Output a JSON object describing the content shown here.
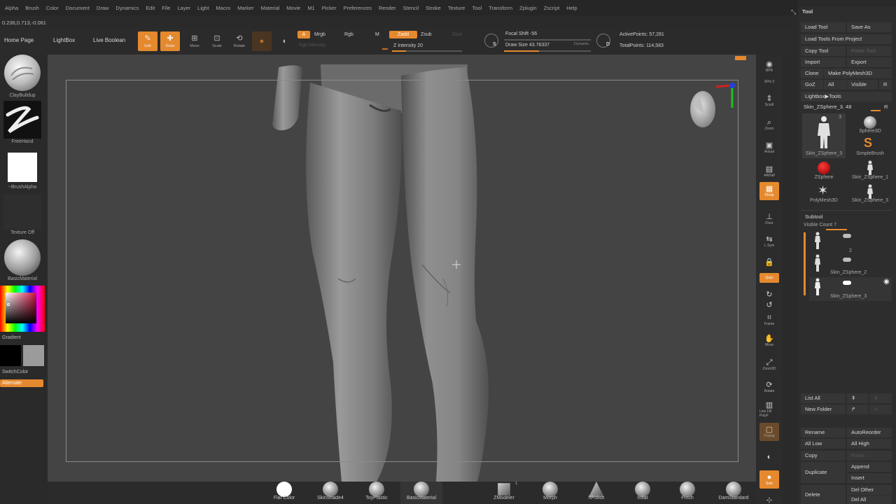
{
  "menu": [
    "Alpha",
    "Brush",
    "Color",
    "Document",
    "Draw",
    "Dynamics",
    "Edit",
    "File",
    "Layer",
    "Light",
    "Macro",
    "Marker",
    "Material",
    "Movie",
    "M1",
    "Picker",
    "Preferences",
    "Render",
    "Stencil",
    "Stroke",
    "Texture",
    "Tool",
    "Transform",
    "Zplugin",
    "Zscript",
    "Help"
  ],
  "coords": "0.236,0.713,-0.061",
  "shelf": {
    "home": "Home Page",
    "lightbox": "LightBox",
    "live_boolean": "Live Boolean",
    "edit": "Edit",
    "draw": "Draw",
    "move": "Move",
    "scale": "Scale",
    "rotate": "Rotate",
    "a": "A",
    "mrgb": "Mrgb",
    "rgb": "Rgb",
    "m": "M",
    "zadd": "Zadd",
    "zsub": "Zsub",
    "zcut": "Zcut",
    "rgb_intensity": "Rgb Intensity",
    "z_intensity": "Z Intensity 20",
    "focal_shift": "Focal Shift -56",
    "draw_size": "Draw Size 43.76337",
    "dynamic": "Dynamic",
    "active_points": "ActivePoints: 57,281",
    "total_points": "TotalPoints: 114,583",
    "s_label": "S",
    "d_label": "D",
    "z_intensity_level": 0.2,
    "draw_size_level": 0.4
  },
  "left": {
    "brush": "ClayBuildup",
    "stroke": "FreeHand",
    "alpha": "~BrushAlpha",
    "texture": "Texture Off",
    "material": "BasicMaterial",
    "gradient": "Gradient",
    "switch_color": "SwitchColor",
    "alternate": "Alternate"
  },
  "right_icons": [
    {
      "name": "bpr",
      "label": "BPR",
      "icon": "◉"
    },
    {
      "name": "spix",
      "label": "SPix 3",
      "icon": ""
    },
    {
      "name": "scroll",
      "label": "Scroll",
      "icon": "⇕"
    },
    {
      "name": "zoom",
      "label": "Zoom",
      "icon": "⌕"
    },
    {
      "name": "actual",
      "label": "Actual",
      "icon": "▣"
    },
    {
      "name": "aahalf",
      "label": "AAHalf",
      "icon": "▤"
    },
    {
      "name": "persp",
      "label": "Persp",
      "icon": "▦"
    },
    {
      "name": "floor",
      "label": "Floor",
      "icon": "⊥"
    },
    {
      "name": "lsym",
      "label": "L.Sym",
      "icon": "⇆"
    },
    {
      "name": "lock",
      "label": "",
      "icon": "🔒"
    },
    {
      "name": "xyz",
      "label": "Qxyz",
      "icon": ""
    },
    {
      "name": "rot1",
      "label": "",
      "icon": "↻"
    },
    {
      "name": "rot2",
      "label": "",
      "icon": "↺"
    },
    {
      "name": "frame",
      "label": "Frame",
      "icon": "⌗"
    },
    {
      "name": "move",
      "label": "Move",
      "icon": "✋"
    },
    {
      "name": "zoom3d",
      "label": "Zoom3D",
      "icon": "⤢"
    },
    {
      "name": "rotate",
      "label": "Rotate",
      "icon": "⟳"
    },
    {
      "name": "linefill",
      "label": "Line Fill PolyF",
      "icon": "▥"
    },
    {
      "name": "transp",
      "label": "Transp",
      "icon": "▢"
    },
    {
      "name": "ghost",
      "label": "",
      "icon": "◐"
    },
    {
      "name": "solo",
      "label": "Solo",
      "icon": "●"
    },
    {
      "name": "xpose",
      "label": "",
      "icon": "⊹"
    }
  ],
  "tool": {
    "title": "Tool",
    "load_tool": "Load Tool",
    "save_as": "Save As",
    "load_tools_from_project": "Load Tools From Project",
    "copy_tool": "Copy Tool",
    "paste_tool": "Paste Tool",
    "import": "Import",
    "export": "Export",
    "clone": "Clone",
    "make_polymesh": "Make PolyMesh3D",
    "goz": "GoZ",
    "all": "All",
    "visible": "Visible",
    "r": "R",
    "lightbox_tools": "Lightbox▶Tools",
    "current_tool": "Skin_ZSphere_3. 48",
    "r2": "R",
    "thumbs": [
      {
        "name": "Skin_ZSphere_3",
        "label": "Skin_ZSphere_3",
        "count": "3"
      },
      {
        "name": "Sphere3D",
        "label": "Sphere3D"
      },
      {
        "name": "SimpleBrush",
        "label": "SimpleBrush"
      },
      {
        "name": "ZSphere",
        "label": "ZSphere"
      },
      {
        "name": "Skin_ZSphere_1",
        "label": "Skin_ZSphere_1"
      },
      {
        "name": "PolyMesh3D",
        "label": "PolyMesh3D"
      },
      {
        "name": "Skin_ZSphere_3b",
        "label": "Skin_ZSphere_3"
      }
    ],
    "subtool": "Subtool",
    "visible_count": "Visible Count 7",
    "subtools": [
      {
        "label": "",
        "num": ""
      },
      {
        "label": "Skin_ZSphere_2",
        "num": "2"
      },
      {
        "label": "Skin_ZSphere_3",
        "num": ""
      }
    ],
    "list_all": "List All",
    "new_folder": "New Folder",
    "rename": "Rename",
    "autoreorder": "AutoReorder",
    "all_low": "All Low",
    "all_high": "All High",
    "copy": "Copy",
    "paste": "Paste",
    "duplicate": "Duplicate",
    "append": "Append",
    "insert": "Insert",
    "delete": "Delete",
    "del_other": "Del Other",
    "del_all": "Del All"
  },
  "bottom": [
    {
      "label": "Flat Color",
      "kind": "white"
    },
    {
      "label": "SkinShade4",
      "kind": "grey"
    },
    {
      "label": "ToyPlastic",
      "kind": "grey"
    },
    {
      "label": "BasicMaterial",
      "kind": "grey"
    },
    {
      "label": "ZModeler",
      "kind": "cube",
      "count": "1"
    },
    {
      "label": "Morph",
      "kind": "grey"
    },
    {
      "label": "hPolish",
      "kind": "cone"
    },
    {
      "label": "Inflat",
      "kind": "grey"
    },
    {
      "label": "Pinch",
      "kind": "grey"
    },
    {
      "label": "DamStandard",
      "kind": "grey"
    }
  ],
  "colors": {
    "accent": "#e5892e",
    "viewport": "#444444",
    "panel": "#2d2d2d"
  }
}
